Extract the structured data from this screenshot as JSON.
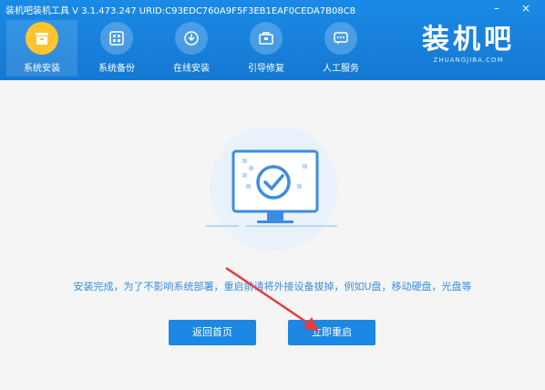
{
  "titlebar": {
    "title": "装机吧装机工具 V 3.1.473.247 URID:C93EDC760A9F5F3EB1EAF0CEDA7B08C8",
    "minimize": "–",
    "close": "×"
  },
  "nav": {
    "items": [
      {
        "label": "系统安装",
        "icon": "system-install-icon"
      },
      {
        "label": "系统备份",
        "icon": "system-backup-icon"
      },
      {
        "label": "在线安装",
        "icon": "online-install-icon"
      },
      {
        "label": "引导修复",
        "icon": "boot-repair-icon"
      },
      {
        "label": "人工服务",
        "icon": "chat-service-icon"
      }
    ],
    "active_index": 0
  },
  "logo": {
    "text": "装机吧",
    "subtext": "ZHUANGJIBA.COM"
  },
  "main": {
    "message": "安装完成，为了不影响系统部署，重启前请将外接设备拔掉，例如U盘，移动硬盘，光盘等",
    "buttons": {
      "home": "返回首页",
      "restart": "立即重启"
    }
  },
  "colors": {
    "header": "#1578d2",
    "accent": "#1d87e4",
    "active_icon": "#ffc52e",
    "message": "#3a8ee0"
  }
}
